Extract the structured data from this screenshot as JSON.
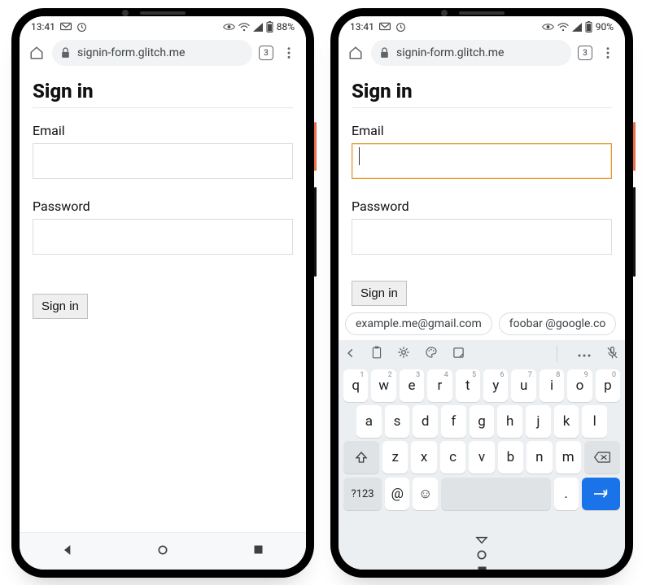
{
  "phones": {
    "left": {
      "status": {
        "time": "13:41",
        "battery": "88%"
      },
      "url": "signin-form.glitch.me",
      "tab_count": "3",
      "page": {
        "title": "Sign in",
        "email_label": "Email",
        "password_label": "Password",
        "submit_label": "Sign in"
      }
    },
    "right": {
      "status": {
        "time": "13:41",
        "battery": "90%"
      },
      "url": "signin-form.glitch.me",
      "tab_count": "3",
      "page": {
        "title": "Sign in",
        "email_label": "Email",
        "password_label": "Password",
        "submit_label": "Sign in"
      },
      "suggestions": [
        "example.me@gmail.com",
        "foobar @google.co"
      ],
      "keyboard": {
        "row1": [
          "q",
          "w",
          "e",
          "r",
          "t",
          "y",
          "u",
          "i",
          "o",
          "p"
        ],
        "row1_sup": [
          "1",
          "2",
          "3",
          "4",
          "5",
          "6",
          "7",
          "8",
          "9",
          "0"
        ],
        "row2": [
          "a",
          "s",
          "d",
          "f",
          "g",
          "h",
          "j",
          "k",
          "l"
        ],
        "row3": [
          "z",
          "x",
          "c",
          "v",
          "b",
          "n",
          "m"
        ],
        "sym_key": "?123",
        "at_key": "@",
        "dot_key": "."
      }
    }
  }
}
